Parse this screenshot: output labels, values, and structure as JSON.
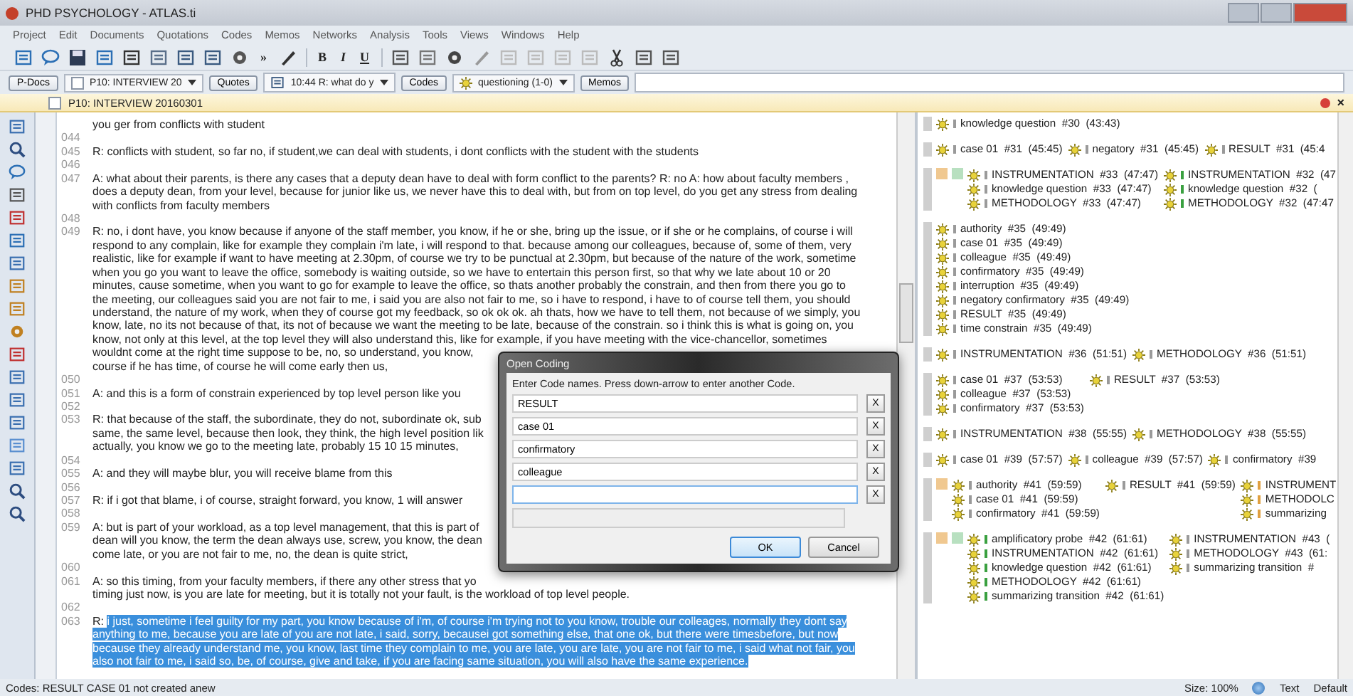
{
  "window": {
    "title": "PHD PSYCHOLOGY - ATLAS.ti"
  },
  "menu": [
    "Project",
    "Edit",
    "Documents",
    "Quotations",
    "Codes",
    "Memos",
    "Networks",
    "Analysis",
    "Tools",
    "Views",
    "Windows",
    "Help"
  ],
  "toolbar": {
    "overflow": "»",
    "format_buttons": [
      "B",
      "I",
      "U"
    ]
  },
  "navigator": [
    {
      "kind": "button",
      "label": "P-Docs"
    },
    {
      "kind": "dropdown",
      "label": "P10: INTERVIEW 20"
    },
    {
      "kind": "button",
      "label": "Quotes"
    },
    {
      "kind": "dropdown",
      "label": "10:44 R: what do y"
    },
    {
      "kind": "button",
      "label": "Codes"
    },
    {
      "kind": "dropdown",
      "label": "questioning (1-0)"
    },
    {
      "kind": "button",
      "label": "Memos"
    }
  ],
  "document": {
    "title": "P10: INTERVIEW 20160301",
    "close_glyph": "×",
    "rows": [
      {
        "highlighted": false,
        "lines": [
          "you ger from conflicts with student"
        ]
      },
      {
        "number": "044",
        "lines": []
      },
      {
        "number": "045",
        "highlighted": false,
        "lines": [
          "R: conflicts with student, so far no, if student,we can deal with students, i dont conflicts with the student with the students"
        ]
      },
      {
        "number": "046",
        "lines": []
      },
      {
        "number": "047",
        "highlighted": false,
        "lines": [
          "A: what about their parents, is there any cases that a deputy dean have to deal with form conflict to the parents? R: no A: how about faculty members ,",
          "does a deputy dean, from your level, because for junior like us, we never have this to deal with, but from on top level, do you get any stress from dealing",
          "with conflicts from faculty members"
        ]
      },
      {
        "number": "048",
        "lines": []
      },
      {
        "number": "049",
        "highlighted": false,
        "lines": [
          "R: no, i dont have, you know because if anyone of the staff member, you know, if he or she, bring up the issue, or if she or he complains, of course i will",
          "respond to any complain, like for example they complain i'm late, i will respond to that. because among our colleagues, because of, some of them, very",
          "realistic, like for example if want to have meeting at 2.30pm, of course we try to be punctual at 2.30pm, but because of the nature of the work, sometime",
          "when you go you want to leave the office, somebody is waiting outside, so we have to entertain this person first, so that why we late about 10 or 20",
          "minutes, cause sometime, when you want to go for example to leave the office, so thats another probably the constrain, and then from there you go to",
          "the meeting, our colleagues said you are not fair to me, i said you are also not fair to me, so i have to respond, i have to of course tell them, you should",
          "understand, the nature of my work, when they of course got my feedback, so ok ok ok. ah thats, how we have to tell them, not because of we simply, you",
          "know, late, no its not because of that, its not of because we want the meeting to be late, because of the constrain. so i think this is what is going on, you",
          "know, not only at this level,  at the top level they will also understand this, like for example, if you have meeting with the vice-chancellor, sometimes",
          "wouldnt come at the right time suppose to be, no, so understand, you know,",
          "course if he has time, of course he will come early then us,"
        ]
      },
      {
        "number": "050",
        "lines": []
      },
      {
        "number": "051",
        "highlighted": false,
        "lines": [
          "A: and this is a form of constrain experienced by top level person like you"
        ]
      },
      {
        "number": "052",
        "lines": []
      },
      {
        "number": "053",
        "highlighted": false,
        "lines": [
          "R: that because of the staff, the subordinate, they do not, subordinate ok, sub",
          "same, the same level, because then look, they think, the high level position lik",
          "actually, you know we go to the meeting late, probably 15 10 15 minutes,"
        ]
      },
      {
        "number": "054",
        "lines": []
      },
      {
        "number": "055",
        "highlighted": false,
        "lines": [
          "A: and they will maybe blur, you will receive blame from this"
        ]
      },
      {
        "number": "056",
        "lines": []
      },
      {
        "number": "057",
        "highlighted": false,
        "lines": [
          "R: if i got that blame, i of course, straight forward, you know, 1 will answer"
        ]
      },
      {
        "number": "058",
        "lines": []
      },
      {
        "number": "059",
        "highlighted": false,
        "lines": [
          "A: but is part of your workload, as a top level management, that this is part of",
          "dean will you know, the term the dean always use, screw, you know, the dean",
          "come late, or you are not fair to me, no, the dean is quite strict,"
        ]
      },
      {
        "number": "060",
        "lines": []
      },
      {
        "number": "061",
        "highlighted": false,
        "lines": [
          "A: so this timing, from your faculty members, if there any other stress that yo",
          "timing just now, is you are late for meeting, but it is totally not your fault, is the workload of top level people."
        ]
      },
      {
        "number": "062",
        "lines": []
      },
      {
        "number": "063",
        "prefix": "R:",
        "highlighted": true,
        "lines": [
          "i just, sometime i feel guilty for my part, you know because of i'm, of course i'm trying not to you know, trouble our colleages, normally they dont say",
          "anything to me, because you are late of you are not late, i said, sorry, becausei got something else, that one ok, but there were timesbefore, but now",
          "because they already understand me, you know, last time they complain to me, you are late, you are late, you are not fair to me, i said what not fair, you",
          "also not fair to me, i said so, be, of course, give and take, if you are facing same situation, you will also have the same experience."
        ]
      }
    ]
  },
  "margin": [
    {
      "columns": [
        {
          "color": "#9a9a9a",
          "codes": [
            "knowledge question  #30  (43:43)"
          ]
        }
      ]
    },
    {
      "columns": [
        {
          "color": "#9a9a9a",
          "codes": [
            "case 01  #31  (45:45)"
          ]
        },
        {
          "color": "#9a9a9a",
          "codes": [
            "negatory  #31  (45:45)"
          ]
        },
        {
          "color": "#9a9a9a",
          "codes": [
            "RESULT  #31  (45:4"
          ]
        }
      ]
    },
    {
      "squares": [
        {
          "color": "#f0c890"
        },
        {
          "color": "#b8e0c0"
        }
      ],
      "columns": [
        {
          "color": "#9a9a9a",
          "codes": [
            "INSTRUMENTATION  #33  (47:47)",
            "knowledge question  #33  (47:47)",
            "METHODOLOGY  #33  (47:47)"
          ]
        },
        {
          "color": "#3aa040",
          "codes": [
            "INSTRUMENTATION  #32  (47",
            "knowledge question  #32  (",
            "METHODOLOGY  #32  (47:47"
          ]
        }
      ]
    },
    {
      "columns": [
        {
          "color": "#9a9a9a",
          "codes": [
            "authority  #35  (49:49)",
            "case 01  #35  (49:49)",
            "colleague  #35  (49:49)",
            "confirmatory  #35  (49:49)",
            "interruption  #35  (49:49)",
            "negatory confirmatory  #35  (49:49)",
            "RESULT  #35  (49:49)",
            "time constrain  #35  (49:49)"
          ]
        }
      ]
    },
    {
      "columns": [
        {
          "color": "#9a9a9a",
          "codes": [
            "INSTRUMENTATION  #36  (51:51)"
          ]
        },
        {
          "color": "#9a9a9a",
          "codes": [
            "METHODOLOGY  #36  (51:51)"
          ]
        }
      ]
    },
    {
      "columns": [
        {
          "color": "#9a9a9a",
          "codes": [
            "case 01  #37  (53:53)",
            "colleague  #37  (53:53)",
            "confirmatory  #37  (53:53)"
          ]
        },
        {
          "color": "#9a9a9a",
          "codes": [
            "RESULT  #37  (53:53)"
          ]
        }
      ]
    },
    {
      "columns": [
        {
          "color": "#9a9a9a",
          "codes": [
            "INSTRUMENTATION  #38  (55:55)"
          ]
        },
        {
          "color": "#9a9a9a",
          "codes": [
            "METHODOLOGY  #38  (55:55)"
          ]
        }
      ]
    },
    {
      "columns": [
        {
          "color": "#9a9a9a",
          "codes": [
            "case 01  #39  (57:57)"
          ]
        },
        {
          "color": "#9a9a9a",
          "codes": [
            "colleague  #39  (57:57)"
          ]
        },
        {
          "color": "#9a9a9a",
          "codes": [
            "confirmatory  #39"
          ]
        }
      ]
    },
    {
      "squares": [
        {
          "color": "#f0c890"
        }
      ],
      "columns": [
        {
          "color": "#9a9a9a",
          "codes": [
            "authority  #41  (59:59)",
            "case 01  #41  (59:59)",
            "confirmatory  #41  (59:59)"
          ]
        },
        {
          "color": "#9a9a9a",
          "codes": [
            "RESULT  #41  (59:59)"
          ]
        },
        {
          "color": "#e0a040",
          "codes": [
            "INSTRUMENT",
            "METHODOLC",
            "summarizing"
          ]
        }
      ]
    },
    {
      "squares": [
        {
          "color": "#f0c890"
        },
        {
          "color": "#b8e0c0"
        }
      ],
      "columns": [
        {
          "color": "#3aa040",
          "codes": [
            "amplificatory probe  #42  (61:61)",
            "INSTRUMENTATION  #42  (61:61)",
            "knowledge question  #42  (61:61)",
            "METHODOLOGY  #42  (61:61)",
            "summarizing transition  #42  (61:61)"
          ]
        },
        {
          "color": "#9a9a9a",
          "codes": [
            "INSTRUMENTATION  #43  (",
            "METHODOLOGY  #43  (61:",
            "summarizing transition  #"
          ]
        }
      ]
    }
  ],
  "dialog": {
    "title": "Open Coding",
    "instruction": "Enter Code names. Press down-arrow to enter another Code.",
    "fields": [
      {
        "value": "RESULT",
        "focused": false,
        "remove_label": "X"
      },
      {
        "value": "case 01",
        "focused": false,
        "remove_label": "X"
      },
      {
        "value": "confirmatory",
        "focused": false,
        "remove_label": "X"
      },
      {
        "value": "colleague",
        "focused": false,
        "remove_label": "X"
      },
      {
        "focused": true,
        "remove_label": "X"
      }
    ],
    "buttons": [
      {
        "label": "OK",
        "default": true
      },
      {
        "label": "Cancel",
        "default": false
      }
    ]
  },
  "status_bar": {
    "message": "Codes: RESULT CASE 01 not created anew",
    "size": "Size: 100%",
    "mode": "Text",
    "style": "Default"
  }
}
